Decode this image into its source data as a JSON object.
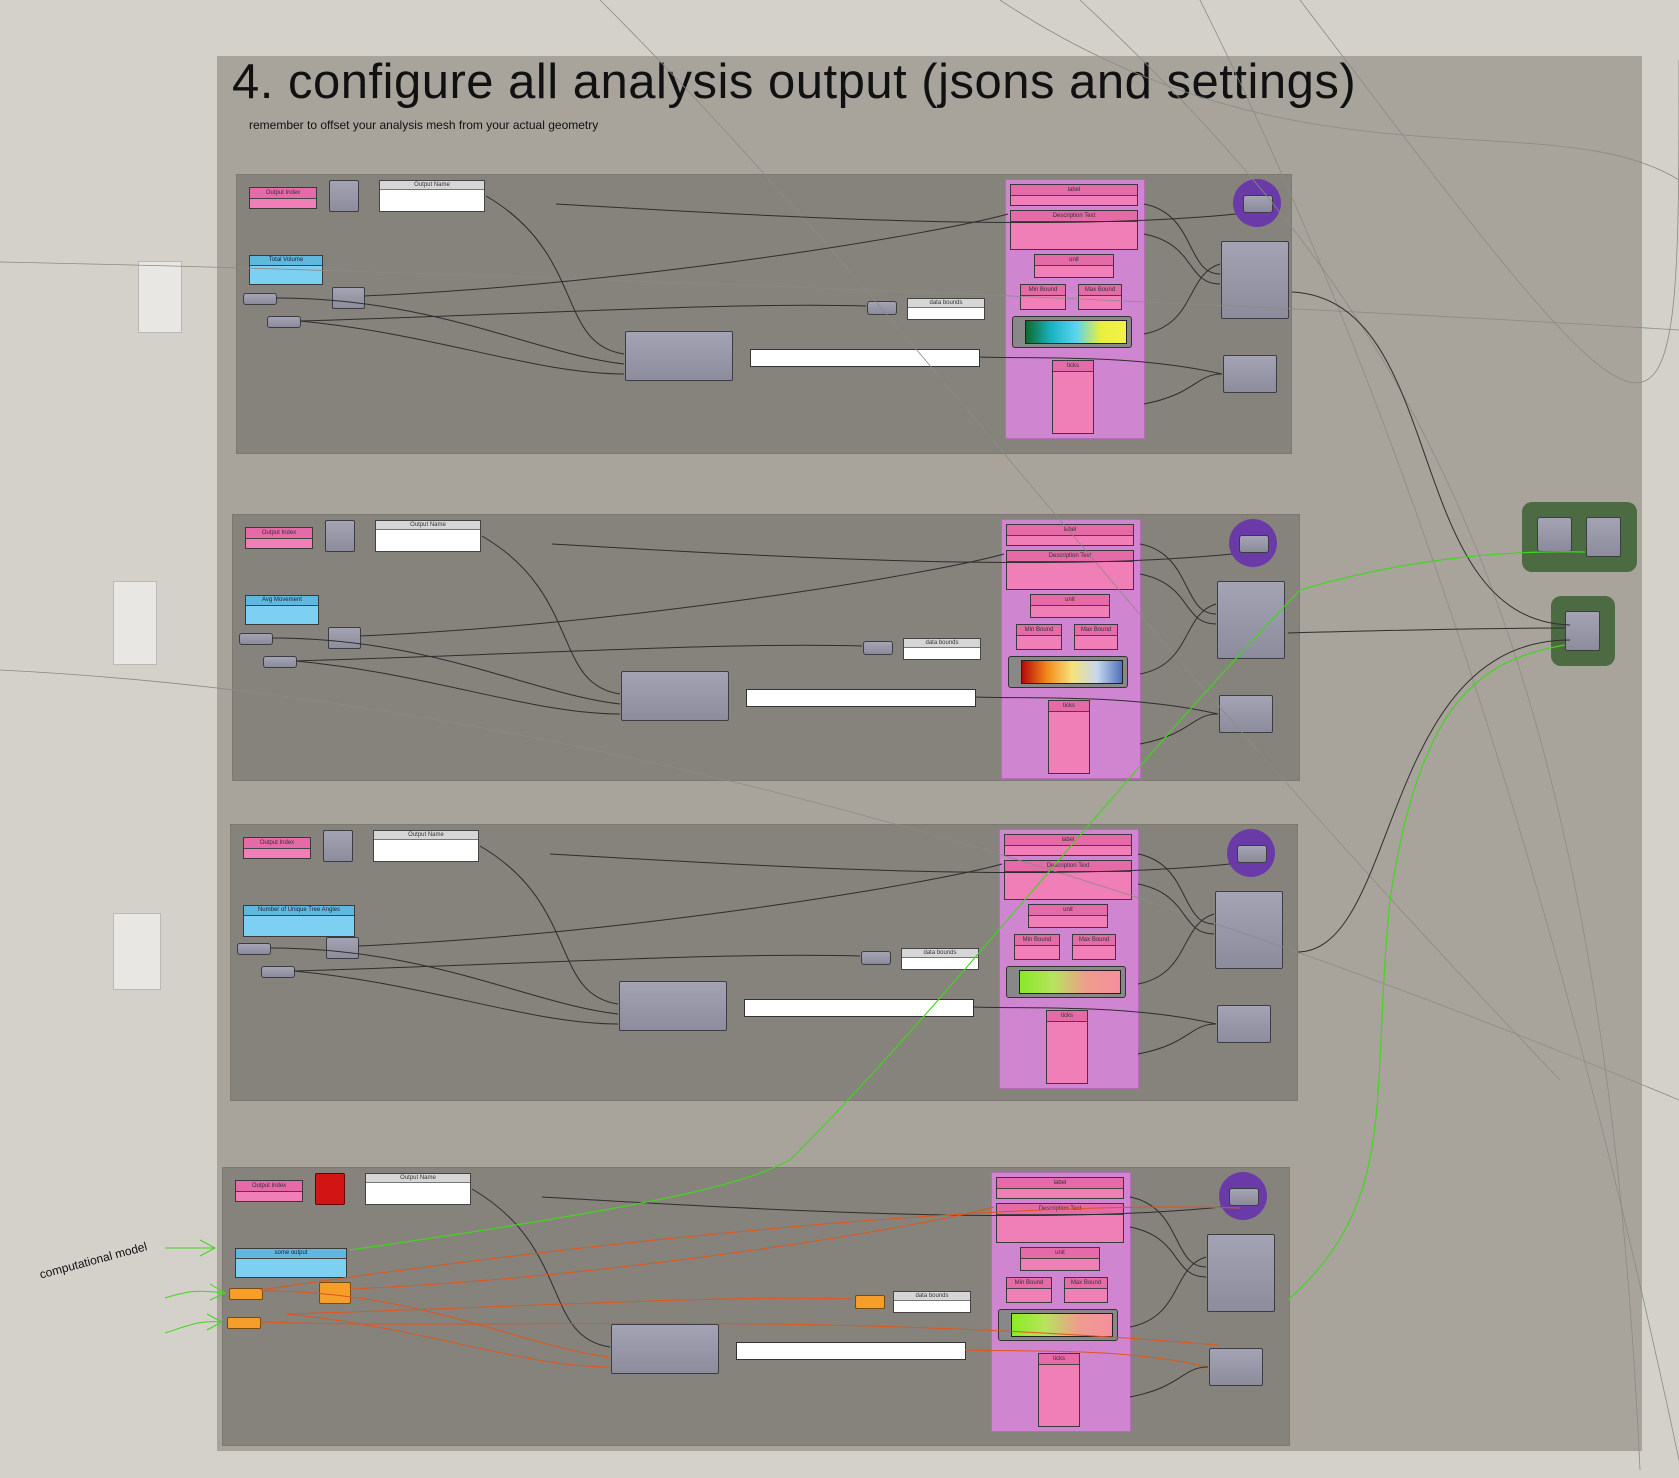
{
  "canvas": {
    "title": "4. configure all analysis output (jsons and settings)",
    "subtitle": "remember to offset your analysis mesh from your actual geometry"
  },
  "groups": [
    {
      "output_index_label": "Output Index",
      "output_name_label": "Output Name",
      "input_label": "Total Volume",
      "data_bounds_label": "data bounds",
      "settings": {
        "label": "label",
        "description": "Description Text",
        "unit": "unit",
        "min_bound": "Min Bound",
        "max_bound": "Max Bound",
        "ticks": "ticks"
      },
      "gradient": "blue-green-yellow"
    },
    {
      "output_index_label": "Output Index",
      "output_name_label": "Output Name",
      "input_label": "Avg Movement",
      "data_bounds_label": "data bounds",
      "settings": {
        "label": "label",
        "description": "Description Text",
        "unit": "unit",
        "min_bound": "Min Bound",
        "max_bound": "Max Bound",
        "ticks": "ticks"
      },
      "gradient": "red-yellow-blue"
    },
    {
      "output_index_label": "Output Index",
      "output_name_label": "Output Name",
      "input_label": "Number of Unique Tree Angles",
      "data_bounds_label": "data bounds",
      "settings": {
        "label": "label",
        "description": "Description Text",
        "unit": "unit",
        "min_bound": "Min Bound",
        "max_bound": "Max Bound",
        "ticks": "ticks"
      },
      "gradient": "green-pink"
    },
    {
      "output_index_label": "Output Index",
      "output_name_label": "Output Name",
      "input_label": "some output",
      "data_bounds_label": "data bounds",
      "settings": {
        "label": "label",
        "description": "Description Text",
        "unit": "unit",
        "min_bound": "Min Bound",
        "max_bound": "Max Bound",
        "ticks": "ticks"
      },
      "gradient": "green-pink"
    }
  ],
  "annotations": {
    "computational_model": "computational model"
  },
  "colors": {
    "canvas": "#d4d0ca",
    "group_outer": "#a8a49c",
    "group_inner": "#86827c",
    "settings_slab": "#cf85cf",
    "parameter_pink": "#f07fb8",
    "parameter_blue": "#7ed0f2",
    "wire_green": "#44d420",
    "wire_orange": "#e0561a",
    "cluster_green": "#4d6b42",
    "purple_node": "#6a3aa8"
  }
}
